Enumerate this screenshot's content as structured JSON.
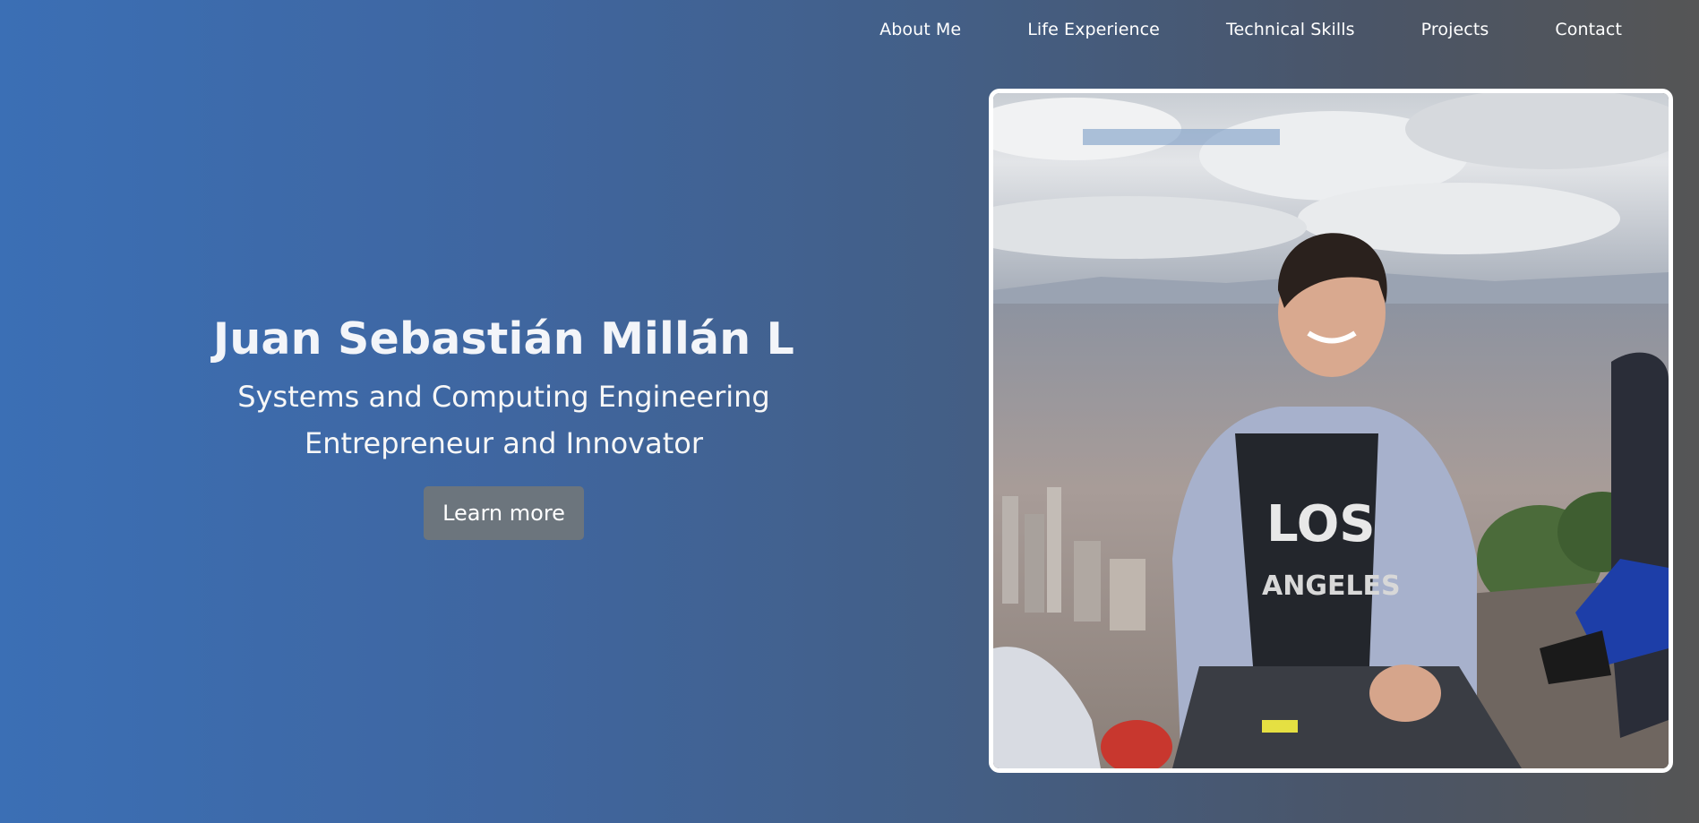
{
  "nav": {
    "items": [
      {
        "label": "About Me"
      },
      {
        "label": "Life Experience"
      },
      {
        "label": "Technical Skills"
      },
      {
        "label": "Projects"
      },
      {
        "label": "Contact"
      }
    ]
  },
  "hero": {
    "name": "Juan Sebastián Millán L",
    "subtitle_1": "Systems and Computing Engineering",
    "subtitle_2": "Entrepreneur and Innovator",
    "button_label": "Learn more"
  },
  "colors": {
    "gradient_start": "#3b6fb5",
    "gradient_end": "#555555",
    "button_bg": "#6c757d"
  }
}
